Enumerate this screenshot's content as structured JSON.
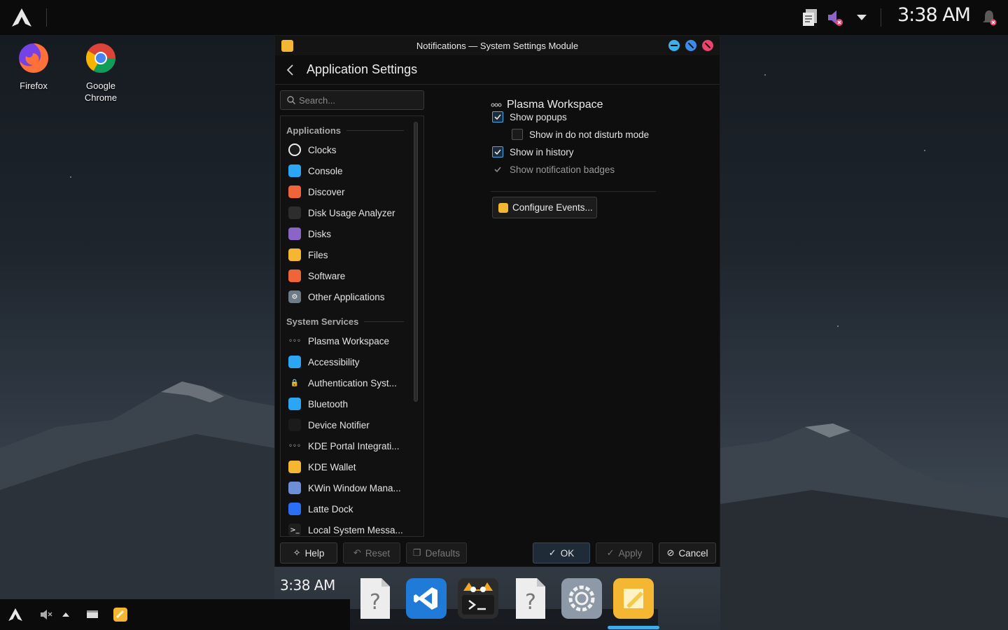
{
  "desktop": {
    "icons": [
      {
        "label": "Firefox"
      },
      {
        "label": "Google Chrome"
      }
    ]
  },
  "top_panel": {
    "clock": "3:38 AM"
  },
  "window": {
    "title": "Notifications — System Settings Module",
    "page_title": "Application Settings",
    "search": {
      "placeholder": "Search...",
      "value": ""
    },
    "sidebar": {
      "sections": [
        {
          "title": "Applications",
          "items": [
            {
              "label": "Clocks",
              "icon": "clock-icon",
              "color": "#1b1b1b"
            },
            {
              "label": "Console",
              "icon": "console-icon",
              "color": "#2aa6f5"
            },
            {
              "label": "Discover",
              "icon": "discover-icon",
              "color": "#f0643a"
            },
            {
              "label": "Disk Usage Analyzer",
              "icon": "disk-usage-icon",
              "color": "#2d2d2d"
            },
            {
              "label": "Disks",
              "icon": "disks-icon",
              "color": "#8b64c8"
            },
            {
              "label": "Files",
              "icon": "files-icon",
              "color": "#f5b731"
            },
            {
              "label": "Software",
              "icon": "software-icon",
              "color": "#f0643a"
            },
            {
              "label": "Other Applications",
              "icon": "gear-icon",
              "color": "#6d7a87"
            }
          ]
        },
        {
          "title": "System Services",
          "items": [
            {
              "label": "Plasma Workspace",
              "icon": "dots-icon",
              "color": "transparent"
            },
            {
              "label": "Accessibility",
              "icon": "accessibility-icon",
              "color": "#2aa6f5"
            },
            {
              "label": "Authentication Syst...",
              "icon": "lock-icon",
              "color": "transparent"
            },
            {
              "label": "Bluetooth",
              "icon": "bluetooth-icon",
              "color": "#2aa6f5"
            },
            {
              "label": "Device Notifier",
              "icon": "device-notifier-icon",
              "color": "#1b1b1b"
            },
            {
              "label": "KDE Portal Integrati...",
              "icon": "dots-icon",
              "color": "transparent"
            },
            {
              "label": "KDE Wallet",
              "icon": "wallet-icon",
              "color": "#f5b731"
            },
            {
              "label": "KWin Window Mana...",
              "icon": "kwin-icon",
              "color": "#6c8fd8"
            },
            {
              "label": "Latte Dock",
              "icon": "latte-icon",
              "color": "#2a6ff5"
            },
            {
              "label": "Local System Messa...",
              "icon": "terminal-icon",
              "color": "#1f1f1f"
            }
          ]
        }
      ]
    },
    "content": {
      "heading": "Plasma Workspace",
      "options": [
        {
          "label": "Show popups",
          "checked": true,
          "indent": false,
          "enabled": true
        },
        {
          "label": "Show in do not disturb mode",
          "checked": false,
          "indent": true,
          "enabled": true
        },
        {
          "label": "Show in history",
          "checked": true,
          "indent": false,
          "enabled": true
        },
        {
          "label": "Show notification badges",
          "checked": true,
          "indent": false,
          "enabled": false
        }
      ],
      "configure_button": "Configure Events..."
    },
    "buttons": {
      "help": "Help",
      "reset": "Reset",
      "defaults": "Defaults",
      "ok": "OK",
      "apply": "Apply",
      "cancel": "Cancel"
    }
  },
  "dock": {
    "clock": "3:38 AM",
    "items": [
      {
        "icon": "unknown-file-icon"
      },
      {
        "icon": "vscode-icon"
      },
      {
        "icon": "terminal-cat-icon"
      },
      {
        "icon": "unknown-file-icon"
      },
      {
        "icon": "system-settings-icon"
      },
      {
        "icon": "notes-icon"
      }
    ]
  },
  "colors": {
    "accent": "#3daee9",
    "window_bg": "#0e0e0e",
    "close": "#e9436f",
    "brand_yellow": "#f5b731"
  }
}
